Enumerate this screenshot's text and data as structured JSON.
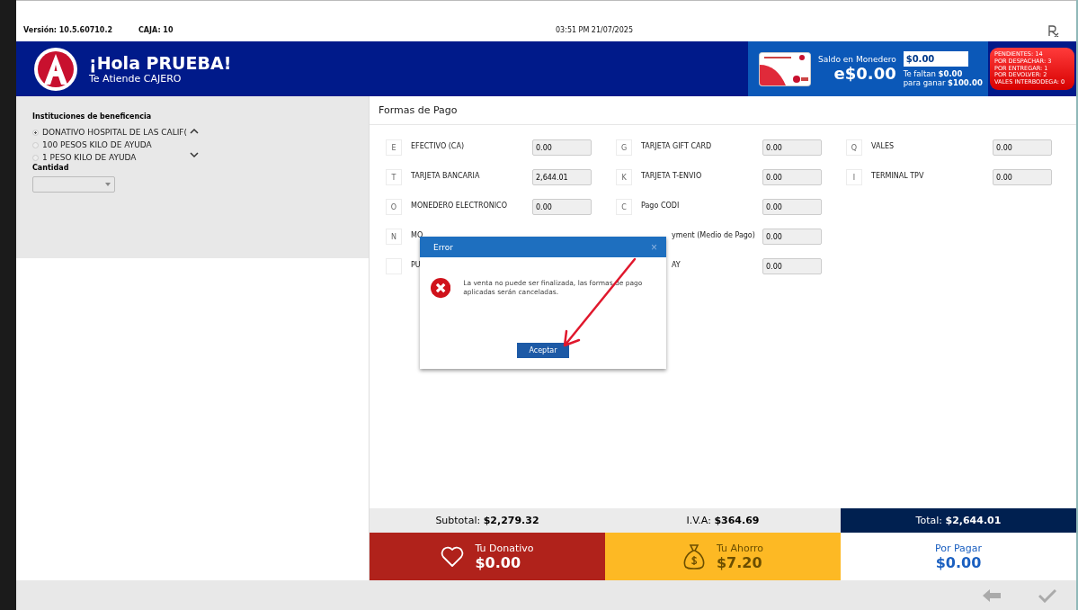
{
  "header": {
    "version": "Versión: 10.5.60710.2",
    "register": "CAJA: 10",
    "datetime": "03:51 PM 21/07/2025"
  },
  "banner": {
    "greeting": "¡Hola PRUEBA!",
    "cashier": "Te Atiende CAJERO"
  },
  "wallet": {
    "label": "Saldo en Monedero",
    "balance": "e$0.00",
    "input_value": "$0.00",
    "missing": "Te faltan **$0.00**",
    "reward": "para ganar **$100.00**"
  },
  "pending": [
    "PENDIENTES: 14",
    "POR DESPACHAR: 3",
    "POR ENTREGAR: 1",
    "POR DEVOLVER: 2",
    "VALES INTERBODEGA: 0"
  ],
  "charity": {
    "title": "Instituciones de beneficencia",
    "options": [
      {
        "label": "DONATIVO HOSPITAL DE LAS CALIF(",
        "selected": true
      },
      {
        "label": "100 PESOS KILO DE AYUDA",
        "selected": false
      },
      {
        "label": "1 PESO KILO DE AYUDA",
        "selected": false
      }
    ],
    "quantity_label": "Cantidad"
  },
  "payments": {
    "title": "Formas de Pago",
    "columns": [
      [
        {
          "kind": "normal",
          "key": "E",
          "label": "EFECTIVO (CA)",
          "value": "0.00"
        },
        {
          "kind": "normal",
          "key": "T",
          "label": "TARJETA BANCARIA",
          "value": "2,644.01"
        },
        {
          "kind": "normal",
          "key": "O",
          "label": "MONEDERO ELECTRONICO",
          "value": "0.00"
        },
        {
          "kind": "covered",
          "key": "N",
          "label": "MO"
        },
        {
          "kind": "covered",
          "label": "PU"
        }
      ],
      [
        {
          "kind": "normal",
          "key": "G",
          "label": "TARJETA GIFT CARD",
          "value": "0.00"
        },
        {
          "kind": "normal",
          "key": "K",
          "label": "TARJETA T-ENVIO",
          "value": "0.00"
        },
        {
          "kind": "normal",
          "key": "C",
          "label": "Pago CODI",
          "value": "0.00"
        },
        {
          "kind": "tail",
          "label": "yment (Medio de Pago)",
          "value": "0.00"
        },
        {
          "kind": "tail",
          "label": "AY",
          "value": "0.00"
        }
      ],
      [
        {
          "kind": "normal",
          "key": "Q",
          "label": "VALES",
          "value": "0.00"
        },
        {
          "kind": "normal",
          "key": "I",
          "label": "TERMINAL TPV",
          "value": "0.00"
        }
      ]
    ]
  },
  "dialog": {
    "title": "Error",
    "close": "×",
    "message": "La venta no puede ser finalizada, las formas de pago aplicadas serán canceladas.",
    "button": "Aceptar"
  },
  "totals": {
    "subtotal": "Subtotal: **$2,279.32**",
    "tax": "I.V.A: **$364.69**",
    "total": "Total: **$2,644.01**"
  },
  "summary": [
    {
      "kind": "donation",
      "label": "Tu Donativo",
      "amount": "$0.00"
    },
    {
      "kind": "savings",
      "label": "Tu Ahorro",
      "amount": "$7.20"
    },
    {
      "kind": "due",
      "label": "Por Pagar",
      "amount": "$0.00"
    }
  ]
}
